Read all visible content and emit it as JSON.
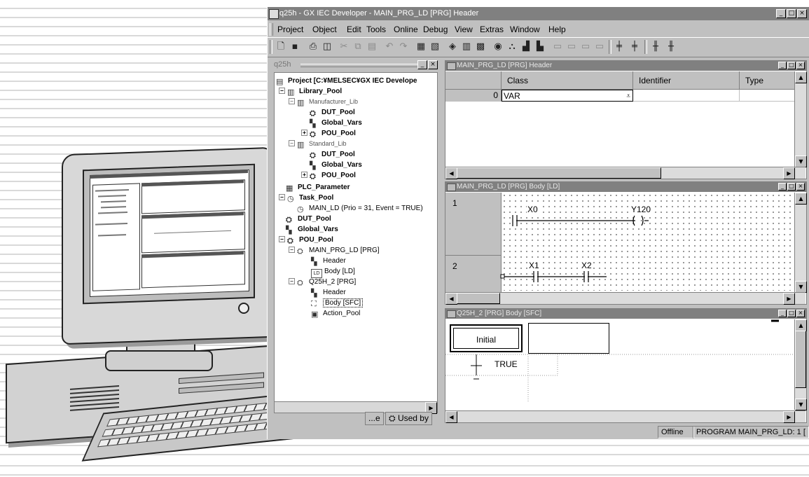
{
  "window": {
    "title": "q25h - GX IEC Developer - MAIN_PRG_LD [PRG] Header"
  },
  "menu": [
    "Project",
    "Object",
    "Edit",
    "Tools",
    "Online",
    "Debug",
    "View",
    "Extras",
    "Window",
    "Help"
  ],
  "toolbar_icons": [
    "new-icon",
    "save-icon",
    "print-icon",
    "print-preview-icon",
    "cut-icon",
    "copy-icon",
    "paste-icon",
    "undo-icon",
    "redo-icon",
    "open-header-icon",
    "open-body-icon",
    "check-icon",
    "compile-icon",
    "build-icon",
    "monitor-icon",
    "transfer-icon",
    "read-icon",
    "write-icon",
    "device-icon",
    "device2-icon",
    "device3-icon",
    "device4-icon",
    "insert-rung-above-icon",
    "insert-rung-below-icon",
    "insert-column-left-icon",
    "insert-column-right-icon"
  ],
  "tree": {
    "title": "q25h",
    "items": [
      {
        "label": "Project [C:¥MELSEC¥GX IEC Develope",
        "icon": "project-icon"
      },
      {
        "label": "Library_Pool",
        "icon": "library-icon"
      },
      {
        "label": "Manufacturer_Lib",
        "icon": "library-icon"
      },
      {
        "label": "DUT_Pool",
        "icon": "dut-icon"
      },
      {
        "label": "Global_Vars",
        "icon": "global-vars-icon"
      },
      {
        "label": "POU_Pool",
        "icon": "pou-icon"
      },
      {
        "label": "Standard_Lib",
        "icon": "library-icon"
      },
      {
        "label": "DUT_Pool",
        "icon": "dut-icon"
      },
      {
        "label": "Global_Vars",
        "icon": "global-vars-icon"
      },
      {
        "label": "POU_Pool",
        "icon": "pou-icon"
      },
      {
        "label": "PLC_Parameter",
        "icon": "plc-parameter-icon"
      },
      {
        "label": "Task_Pool",
        "icon": "task-icon"
      },
      {
        "label": "MAIN_LD (Prio = 31, Event = TRUE)",
        "icon": "task-icon"
      },
      {
        "label": "DUT_Pool",
        "icon": "dut-icon"
      },
      {
        "label": "Global_Vars",
        "icon": "global-vars-icon"
      },
      {
        "label": "POU_Pool",
        "icon": "pou-icon"
      },
      {
        "label": "MAIN_PRG_LD [PRG]",
        "icon": "program-icon"
      },
      {
        "label": "Header",
        "icon": "header-icon"
      },
      {
        "label": "Body [LD]",
        "icon": "body-ld-icon",
        "badge": "LD"
      },
      {
        "label": "Q25H_2 [PRG]",
        "icon": "program-icon"
      },
      {
        "label": "Header",
        "icon": "header-icon"
      },
      {
        "label": "Body [SFC]",
        "icon": "body-sfc-icon"
      },
      {
        "label": "Action_Pool",
        "icon": "action-pool-icon"
      }
    ],
    "tabs": [
      "...e",
      "Used by"
    ]
  },
  "header_window": {
    "title": "MAIN_PRG_LD [PRG] Header",
    "columns": [
      "",
      "Class",
      "Identifier",
      "Type"
    ],
    "rows": [
      {
        "index": "0",
        "class": "VAR",
        "identifier": "",
        "type": ""
      }
    ]
  },
  "ld_window": {
    "title": "MAIN_PRG_LD [PRG] Body [LD]",
    "rungs": [
      {
        "number": "1",
        "contacts": [
          "X0"
        ],
        "coil": "Y120"
      },
      {
        "number": "2",
        "contacts": [
          "X1",
          "X2"
        ],
        "coil": ""
      }
    ]
  },
  "sfc_window": {
    "title": "Q25H_2 [PRG] Body [SFC]",
    "initial_step": "Initial",
    "transition": "TRUE"
  },
  "statusbar": {
    "mode": "Offline",
    "program": "PROGRAM MAIN_PRG_LD: 1 [",
    "badge_ld": "LD"
  },
  "colors": {
    "titlebar_inactive": "#808080",
    "face": "#c0c0c0"
  }
}
